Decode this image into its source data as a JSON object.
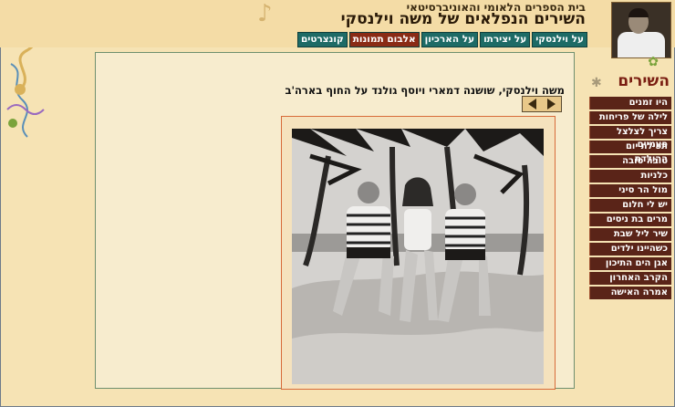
{
  "header": {
    "subtitle": "בית הספרים הלאומי והאוניברסיטאי",
    "title": "השירים הנפלאים של משה וילנסקי"
  },
  "topnav": [
    {
      "label": "על וילנסקי",
      "active": false
    },
    {
      "label": "על יצירתו",
      "active": false
    },
    {
      "label": "על הארכיון",
      "active": false
    },
    {
      "label": "אלבום תמונות",
      "active": true
    },
    {
      "label": "קונצרטים",
      "active": false
    }
  ],
  "sidebar": {
    "heading": "השירים",
    "items": [
      "היו זמנים",
      "לילה של פריחות",
      "צריך לצלצל פעמיים",
      "תפילת יום ההולדת",
      "טובה טובה",
      "כלניות",
      "מול הר סיני",
      "יש לי חלום",
      "מרים בת ניסים",
      "שיר ליל שבת",
      "כשהיינו ילדים",
      "אגן הים התיכון",
      "הקרב האחרון",
      "אמרה האישה"
    ]
  },
  "album": {
    "caption": "משה וילנסקי, שושנה דמארי ויוסף גולנד על החוף בארה'ב"
  },
  "colors": {
    "background": "#f6e3b4",
    "nav_tab": "#1e6b66",
    "nav_tab_active": "#8a2b15",
    "sidebar_item": "#5a2418",
    "heading": "#7a1e12"
  }
}
